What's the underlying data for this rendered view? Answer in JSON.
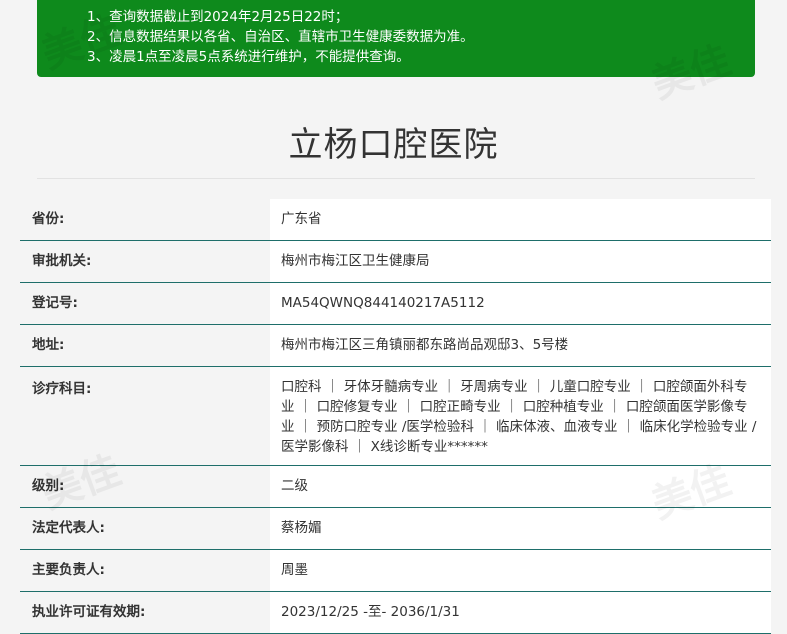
{
  "notice": {
    "lines": [
      "1、查询数据截止到2024年2月25日22时；",
      "2、信息数据结果以各省、自治区、直辖市卫生健康委数据为准。",
      "3、凌晨1点至凌晨5点系统进行维护，不能提供查询。"
    ]
  },
  "title": "立杨口腔医院",
  "rows": [
    {
      "label": "省份:",
      "value": "广东省"
    },
    {
      "label": "审批机关:",
      "value": "梅州市梅江区卫生健康局"
    },
    {
      "label": "登记号:",
      "value": "MA54QWNQ844140217A5112"
    },
    {
      "label": "地址:",
      "value": "梅州市梅江区三角镇丽都东路尚品观邸3、5号楼"
    },
    {
      "label": "诊疗科目:",
      "value": "口腔科 ｜ 牙体牙髓病专业 ｜ 牙周病专业 ｜ 儿童口腔专业 ｜ 口腔颌面外科专业 ｜ 口腔修复专业 ｜ 口腔正畸专业 ｜ 口腔种植专业 ｜ 口腔颌面医学影像专业 ｜ 预防口腔专业 /医学检验科 ｜ 临床体液、血液专业 ｜ 临床化学检验专业 /医学影像科 ｜ X线诊断专业******"
    },
    {
      "label": "级别:",
      "value": "二级"
    },
    {
      "label": "法定代表人:",
      "value": "蔡杨媚"
    },
    {
      "label": "主要负责人:",
      "value": "周墨"
    },
    {
      "label": "执业许可证有效期:",
      "value": "2023/12/25 -至- 2036/1/31"
    }
  ],
  "watermark_text": "美佳"
}
